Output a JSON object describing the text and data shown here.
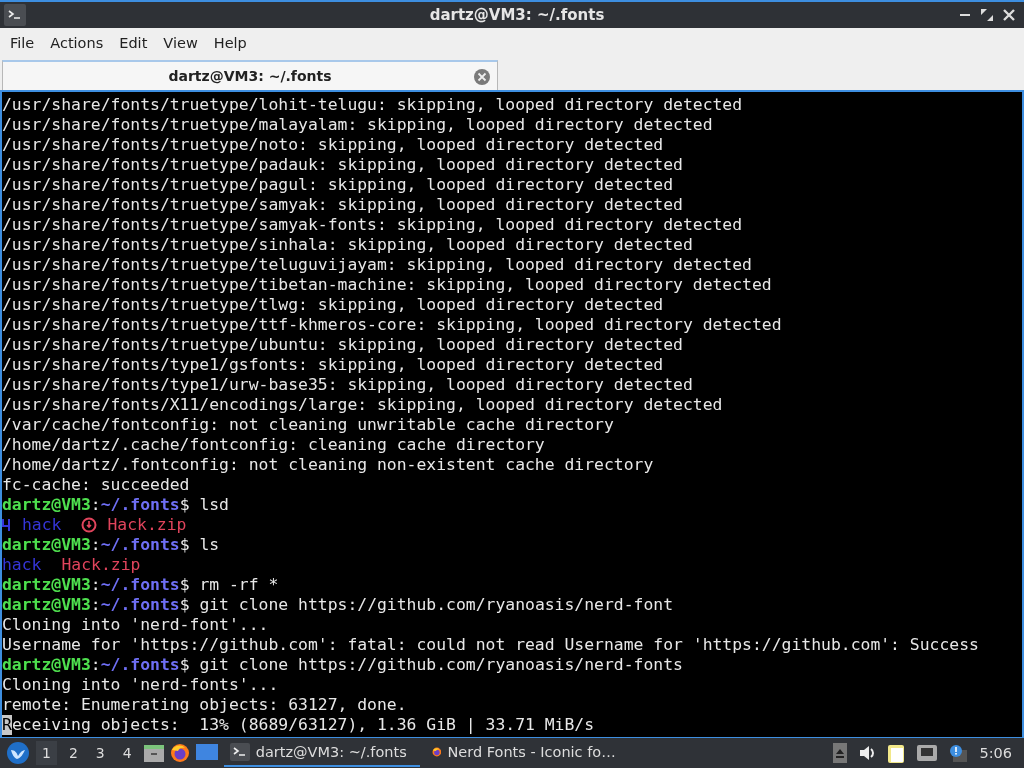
{
  "window": {
    "title": "dartz@VM3: ~/.fonts"
  },
  "menu": [
    "File",
    "Actions",
    "Edit",
    "View",
    "Help"
  ],
  "tabs": [
    {
      "label": "dartz@VM3: ~/.fonts",
      "selected": true
    }
  ],
  "terminal": {
    "lines": [
      [
        {
          "kind": "plain",
          "text": "/usr/share/fonts/truetype/lohit-telugu: skipping, looped directory detected"
        }
      ],
      [
        {
          "kind": "plain",
          "text": "/usr/share/fonts/truetype/malayalam: skipping, looped directory detected"
        }
      ],
      [
        {
          "kind": "plain",
          "text": "/usr/share/fonts/truetype/noto: skipping, looped directory detected"
        }
      ],
      [
        {
          "kind": "plain",
          "text": "/usr/share/fonts/truetype/padauk: skipping, looped directory detected"
        }
      ],
      [
        {
          "kind": "plain",
          "text": "/usr/share/fonts/truetype/pagul: skipping, looped directory detected"
        }
      ],
      [
        {
          "kind": "plain",
          "text": "/usr/share/fonts/truetype/samyak: skipping, looped directory detected"
        }
      ],
      [
        {
          "kind": "plain",
          "text": "/usr/share/fonts/truetype/samyak-fonts: skipping, looped directory detected"
        }
      ],
      [
        {
          "kind": "plain",
          "text": "/usr/share/fonts/truetype/sinhala: skipping, looped directory detected"
        }
      ],
      [
        {
          "kind": "plain",
          "text": "/usr/share/fonts/truetype/teluguvijayam: skipping, looped directory detected"
        }
      ],
      [
        {
          "kind": "plain",
          "text": "/usr/share/fonts/truetype/tibetan-machine: skipping, looped directory detected"
        }
      ],
      [
        {
          "kind": "plain",
          "text": "/usr/share/fonts/truetype/tlwg: skipping, looped directory detected"
        }
      ],
      [
        {
          "kind": "plain",
          "text": "/usr/share/fonts/truetype/ttf-khmeros-core: skipping, looped directory detected"
        }
      ],
      [
        {
          "kind": "plain",
          "text": "/usr/share/fonts/truetype/ubuntu: skipping, looped directory detected"
        }
      ],
      [
        {
          "kind": "plain",
          "text": "/usr/share/fonts/type1/gsfonts: skipping, looped directory detected"
        }
      ],
      [
        {
          "kind": "plain",
          "text": "/usr/share/fonts/type1/urw-base35: skipping, looped directory detected"
        }
      ],
      [
        {
          "kind": "plain",
          "text": "/usr/share/fonts/X11/encodings/large: skipping, looped directory detected"
        }
      ],
      [
        {
          "kind": "plain",
          "text": "/var/cache/fontconfig: not cleaning unwritable cache directory"
        }
      ],
      [
        {
          "kind": "plain",
          "text": "/home/dartz/.cache/fontconfig: cleaning cache directory"
        }
      ],
      [
        {
          "kind": "plain",
          "text": "/home/dartz/.fontconfig: not cleaning non-existent cache directory"
        }
      ],
      [
        {
          "kind": "plain",
          "text": "fc-cache: succeeded"
        }
      ],
      [
        {
          "kind": "user",
          "text": "dartz@VM3"
        },
        {
          "kind": "plain",
          "text": ":"
        },
        {
          "kind": "path",
          "text": "~/.fonts"
        },
        {
          "kind": "plain",
          "text": "$ lsd"
        }
      ],
      [
        {
          "kind": "dir-icon"
        },
        {
          "kind": "dir",
          "text": "hack"
        },
        {
          "kind": "zip-icon"
        },
        {
          "kind": "file",
          "text": "Hack.zip"
        }
      ],
      [
        {
          "kind": "user",
          "text": "dartz@VM3"
        },
        {
          "kind": "plain",
          "text": ":"
        },
        {
          "kind": "path",
          "text": "~/.fonts"
        },
        {
          "kind": "plain",
          "text": "$ ls"
        }
      ],
      [
        {
          "kind": "dir",
          "text": "hack"
        },
        {
          "kind": "file",
          "text": "Hack.zip"
        }
      ],
      [
        {
          "kind": "user",
          "text": "dartz@VM3"
        },
        {
          "kind": "plain",
          "text": ":"
        },
        {
          "kind": "path",
          "text": "~/.fonts"
        },
        {
          "kind": "plain",
          "text": "$ rm -rf *"
        }
      ],
      [
        {
          "kind": "user",
          "text": "dartz@VM3"
        },
        {
          "kind": "plain",
          "text": ":"
        },
        {
          "kind": "path",
          "text": "~/.fonts"
        },
        {
          "kind": "plain",
          "text": "$ git clone https://github.com/ryanoasis/nerd-font"
        }
      ],
      [
        {
          "kind": "plain",
          "text": "Cloning into 'nerd-font'..."
        }
      ],
      [
        {
          "kind": "plain",
          "text": "Username for 'https://github.com': fatal: could not read Username for 'https://github.com': Success"
        }
      ],
      [
        {
          "kind": "user",
          "text": "dartz@VM3"
        },
        {
          "kind": "plain",
          "text": ":"
        },
        {
          "kind": "path",
          "text": "~/.fonts"
        },
        {
          "kind": "plain",
          "text": "$ git clone https://github.com/ryanoasis/nerd-fonts"
        }
      ],
      [
        {
          "kind": "plain",
          "text": "Cloning into 'nerd-fonts'..."
        }
      ],
      [
        {
          "kind": "plain",
          "text": "remote: Enumerating objects: 63127, done."
        }
      ],
      [
        {
          "kind": "cursor",
          "text": "R"
        },
        {
          "kind": "plain",
          "text": "eceiving objects:  13% (8689/63127), 1.36 GiB | 33.71 MiB/s"
        }
      ]
    ]
  },
  "taskbar": {
    "desktops": [
      {
        "label": "1",
        "selected": true
      },
      {
        "label": "2",
        "selected": false
      },
      {
        "label": "3",
        "selected": false
      },
      {
        "label": "4",
        "selected": false
      }
    ],
    "tasks": [
      {
        "kind": "terminal",
        "label": "dartz@VM3: ~/.fonts",
        "selected": true
      },
      {
        "kind": "browser",
        "label": "Nerd Fonts - Iconic fo…",
        "selected": false
      }
    ],
    "clock": "5:06"
  }
}
